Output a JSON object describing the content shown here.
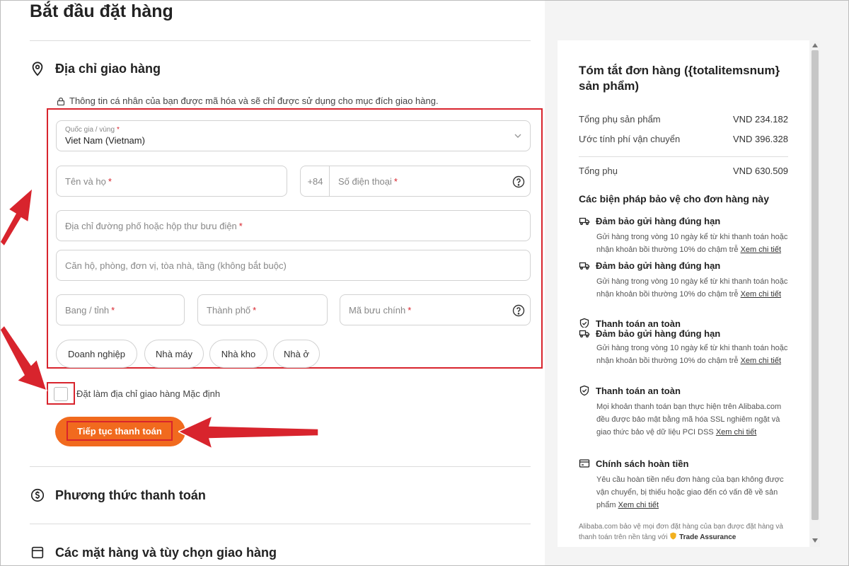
{
  "page": {
    "title": "Bắt đầu đặt hàng"
  },
  "shipping": {
    "heading": "Địa chỉ giao hàng",
    "privacy_note": "Thông tin cá nhân của bạn được mã hóa và sẽ chỉ được sử dụng cho mục đích giao hàng.",
    "country_label": "Quốc gia / vùng",
    "country_value": "Viet Nam (Vietnam)",
    "name_placeholder": "Tên và họ",
    "phone_prefix": "+84",
    "phone_placeholder": "Số điện thoại",
    "street_placeholder": "Địa chỉ đường phố hoặc hộp thư bưu điện",
    "apartment_placeholder": "Căn hộ, phòng, đơn vị, tòa nhà, tầng (không bắt buộc)",
    "state_placeholder": "Bang / tỉnh",
    "city_placeholder": "Thành phố",
    "postal_placeholder": "Mã bưu chính",
    "address_types": [
      "Doanh nghiệp",
      "Nhà máy",
      "Nhà kho",
      "Nhà ở"
    ],
    "default_checkbox_label": "Đặt làm địa chỉ giao hàng Mặc định",
    "continue_button": "Tiếp tục thanh toán",
    "required_mark": "*"
  },
  "sections": {
    "payment": "Phương thức thanh toán",
    "items": "Các mặt hàng và tùy chọn giao hàng"
  },
  "summary": {
    "title": "Tóm tắt đơn hàng ({totalitemsnum} sản phẩm)",
    "rows": [
      {
        "label": "Tổng phụ sản phẩm",
        "value": "VND 234.182"
      },
      {
        "label": "Ước tính phí vận chuyển",
        "value": "VND 396.328"
      },
      {
        "label": "Tổng phụ",
        "value": "VND 630.509"
      }
    ],
    "protection_title": "Các biện pháp bảo vệ cho đơn hàng này",
    "protections": [
      {
        "title": "Đảm bảo gửi hàng đúng hạn",
        "desc": "Gửi hàng trong vòng 10 ngày kể từ khi thanh toán hoặc nhận khoản bồi thường 10% do chậm trễ",
        "link": "Xem chi tiết"
      },
      {
        "title": "Đảm bảo gửi hàng đúng hạn",
        "desc": "Gửi hàng trong vòng 10 ngày kể từ khi thanh toán hoặc nhận khoản bồi thường 10% do chậm trễ",
        "link": "Xem chi tiết"
      },
      {
        "title": "Thanh toán an toàn",
        "desc": "",
        "link": ""
      },
      {
        "title": "Đảm bảo gửi hàng đúng hạn",
        "desc": "Gửi hàng trong vòng 10 ngày kể từ khi thanh toán hoặc nhận khoản bồi thường 10% do chậm trễ",
        "link": "Xem chi tiết"
      },
      {
        "title": "Thanh toán an toàn",
        "desc": "Mọi khoản thanh toán bạn thực hiện trên Alibaba.com đều được bảo mật bằng mã hóa SSL nghiêm ngặt và giao thức bảo vệ dữ liệu PCI DSS",
        "link": "Xem chi tiết"
      },
      {
        "title": "Chính sách hoàn tiền",
        "desc": "Yêu cầu hoàn tiền nếu đơn hàng của bạn không được vận chuyển, bị thiếu hoặc giao đến có vấn đề về sản phẩm",
        "link": "Xem chi tiết"
      }
    ],
    "footer_note": "Alibaba.com bảo vệ mọi đơn đặt hàng của bạn được đặt hàng và thanh toán trên nền tảng với",
    "footer_badge": "Trade Assurance"
  },
  "colors": {
    "accent_orange": "#f16a1e",
    "highlight_red": "#d8242d"
  }
}
